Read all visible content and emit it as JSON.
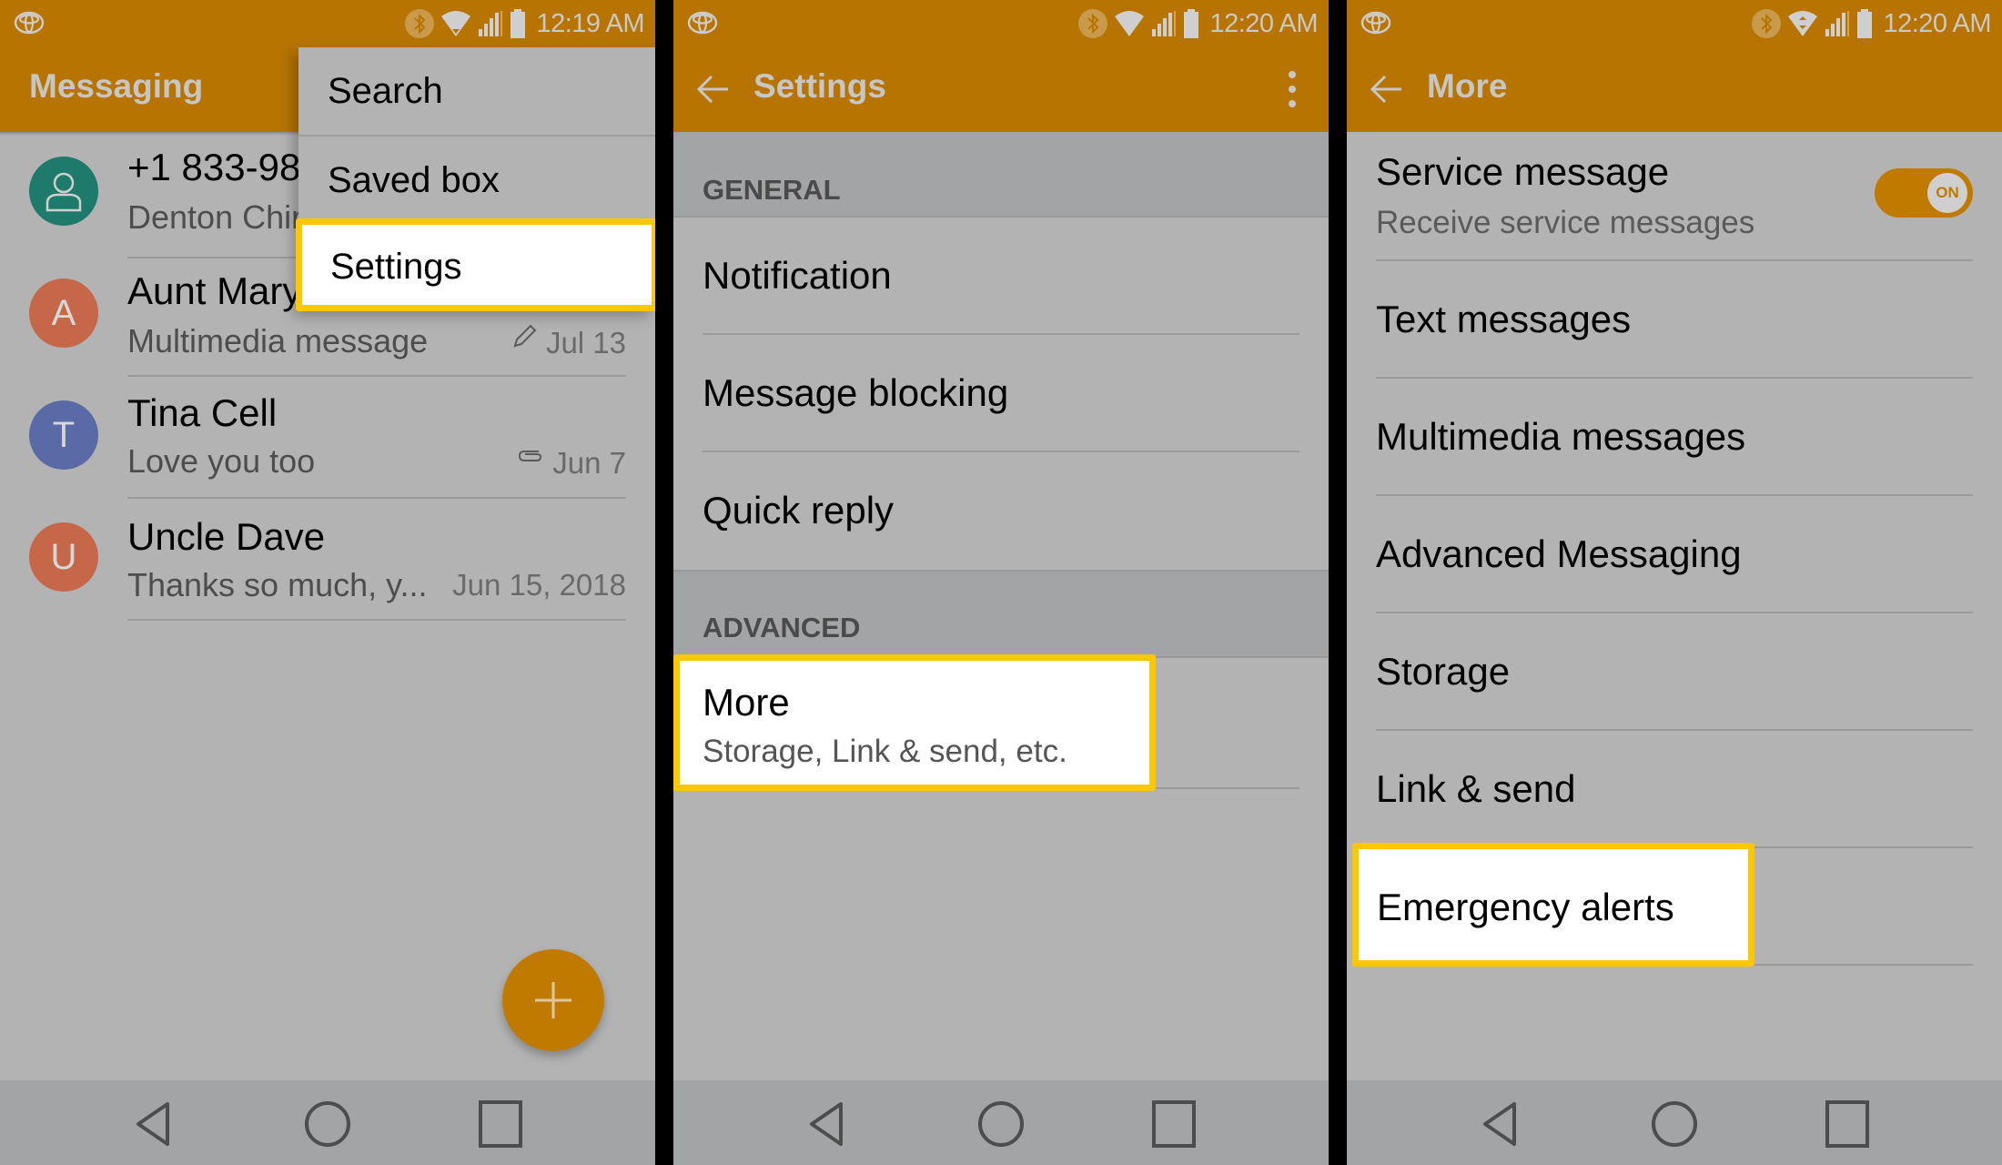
{
  "panels": [
    {
      "status": {
        "time": "12:19 AM"
      },
      "appbar": {
        "title": "Messaging"
      },
      "conversations": [
        {
          "name": "+1 833-98",
          "snippet": "Denton Chir",
          "date": "",
          "avatar_letter": "",
          "avatar_color": "#1e7a6a",
          "avatar_icon": "person-icon",
          "meta_icon": ""
        },
        {
          "name": "Aunt Mary",
          "snippet": "Multimedia message",
          "date": "Jul 13",
          "avatar_letter": "A",
          "avatar_color": "#c7674a",
          "meta_icon": "pencil-icon"
        },
        {
          "name": "Tina Cell",
          "snippet": "Love you too",
          "date": "Jun 7",
          "avatar_letter": "T",
          "avatar_color": "#5a6aa6",
          "meta_icon": "paperclip-icon"
        },
        {
          "name": "Uncle Dave",
          "snippet": "Thanks so much, y...",
          "date": "Jun 15, 2018",
          "avatar_letter": "U",
          "avatar_color": "#c7674a",
          "meta_icon": ""
        }
      ],
      "menu": {
        "items": [
          "Search",
          "Saved box",
          "Settings"
        ],
        "highlighted": "Settings"
      },
      "fab": {
        "icon": "plus-icon"
      }
    },
    {
      "status": {
        "time": "12:20 AM"
      },
      "appbar": {
        "title": "Settings"
      },
      "sections": [
        {
          "label": "GENERAL",
          "items": [
            {
              "title": "Notification"
            },
            {
              "title": "Message blocking"
            },
            {
              "title": "Quick reply"
            }
          ]
        },
        {
          "label": "ADVANCED",
          "items": [
            {
              "title": "More",
              "subtitle": "Storage, Link & send, etc."
            }
          ]
        }
      ],
      "highlighted": "More"
    },
    {
      "status": {
        "time": "12:20 AM"
      },
      "appbar": {
        "title": "More"
      },
      "items": [
        {
          "title": "Service message",
          "subtitle": "Receive service messages",
          "toggle": "ON"
        },
        {
          "title": "Text messages"
        },
        {
          "title": "Multimedia messages"
        },
        {
          "title": "Advanced Messaging"
        },
        {
          "title": "Storage"
        },
        {
          "title": "Link & send"
        },
        {
          "title": "Emergency alerts"
        }
      ],
      "highlighted": "Emergency alerts"
    }
  ],
  "colors": {
    "accent": "#b77400",
    "highlight": "#fdc800"
  }
}
